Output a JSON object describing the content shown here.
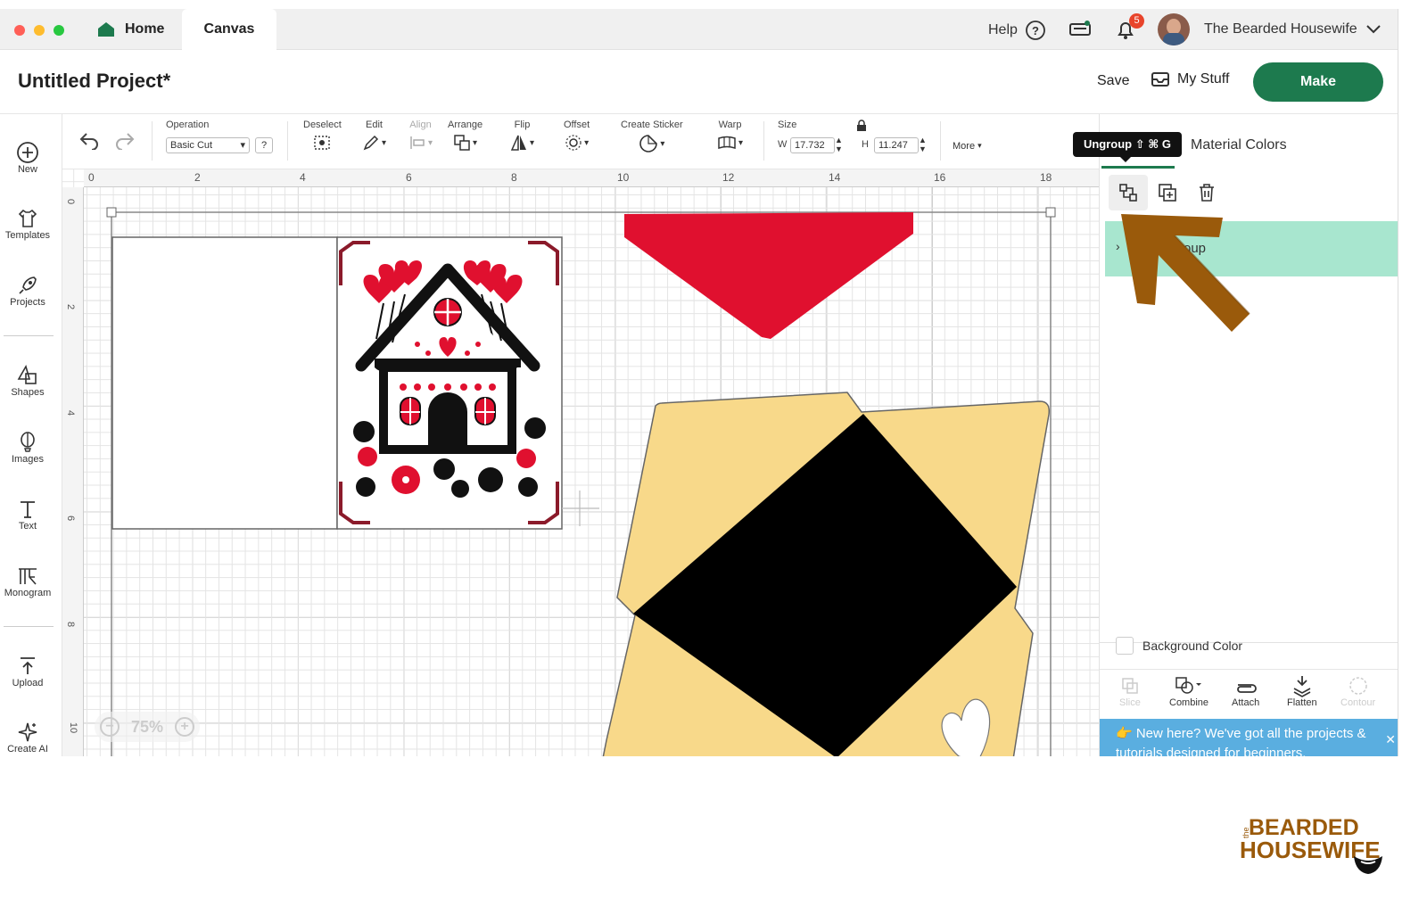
{
  "titlebar": {
    "home_tab": "Home",
    "canvas_tab": "Canvas",
    "help": "Help",
    "notification_count": "5",
    "user_name": "The Bearded Housewife"
  },
  "project": {
    "title": "Untitled Project*",
    "save": "Save",
    "my_stuff": "My Stuff",
    "make": "Make"
  },
  "toolbar": {
    "operation_label": "Operation",
    "operation_value": "Basic Cut",
    "operation_help": "?",
    "deselect": "Deselect",
    "edit": "Edit",
    "align": "Align",
    "arrange": "Arrange",
    "flip": "Flip",
    "offset": "Offset",
    "create_sticker": "Create Sticker",
    "warp": "Warp",
    "size": "Size",
    "w_label": "W",
    "w_value": "17.732",
    "h_label": "H",
    "h_value": "11.247",
    "more": "More"
  },
  "leftnav": [
    "New",
    "Templates",
    "Projects",
    "Shapes",
    "Images",
    "Text",
    "Monogram",
    "Upload",
    "Create AI"
  ],
  "ruler": {
    "h_ticks": [
      "0",
      "2",
      "4",
      "6",
      "8",
      "10",
      "12",
      "14",
      "16",
      "18"
    ],
    "v_ticks": [
      "0",
      "2",
      "4",
      "6",
      "8",
      "10"
    ]
  },
  "canvas": {
    "zoom": "75%"
  },
  "rightpanel": {
    "tooltip": "Ungroup ⇧ ⌘ G",
    "material_colors": "Material Colors",
    "layer_label": "Group",
    "layer_label_visible": "oup",
    "background_color": "Background Color",
    "ops": [
      "Slice",
      "Combine",
      "Attach",
      "Flatten",
      "Contour"
    ],
    "banner": "👉 New here? We've got all the projects & tutorials designed for beginners."
  },
  "logo": {
    "line1": "BEARDED",
    "line2": "HOUSEWIFE",
    "prefix": "the"
  },
  "colors": {
    "make_green": "#1d7a4e",
    "layer_highlight": "#a8e6cf",
    "arrow": "#9a5a0b",
    "red": "#e0102f",
    "yellow": "#f8d98a",
    "banner_blue": "#5aaee0"
  }
}
